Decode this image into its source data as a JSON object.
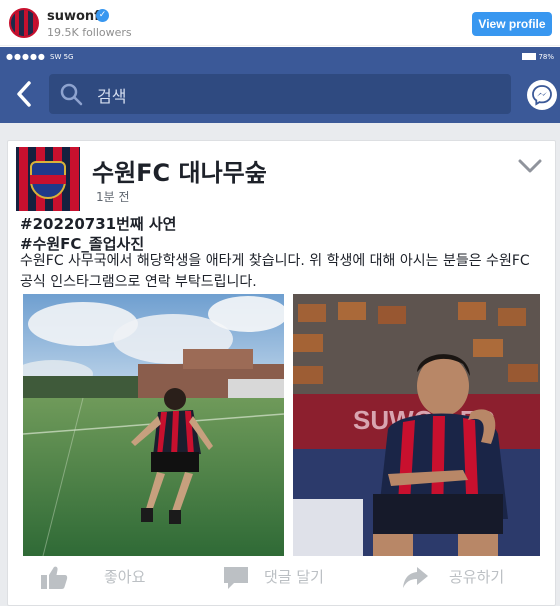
{
  "instagram": {
    "username": "suwonfc",
    "followers": "19.5K followers",
    "view_profile": "View profile"
  },
  "status_bar": {
    "signal": "●●●●●",
    "carrier": "SW 5G",
    "battery": "78%"
  },
  "facebook": {
    "search_placeholder": "검색"
  },
  "post": {
    "page_name": "수원FC 대나무숲",
    "time": "1분 전",
    "hashtag1": "#20220731번째 사연",
    "hashtag2": "#수원FC_졸업사진",
    "body": "수원FC 사무국에서 해당학생을 애타게 찾습니다. 위 학생에 대해 아시는 분들은 수원FC 공식 인스타그램으로 연락 부탁드립니다.",
    "photo2_banner": "SUWON FC",
    "actions": {
      "like": "좋아요",
      "comment": "댓글 달기",
      "share": "공유하기"
    }
  },
  "colors": {
    "facebook_blue": "#3b5998",
    "instagram_blue": "#3897f0",
    "suwon_red": "#c8102e",
    "suwon_navy": "#15213f"
  }
}
